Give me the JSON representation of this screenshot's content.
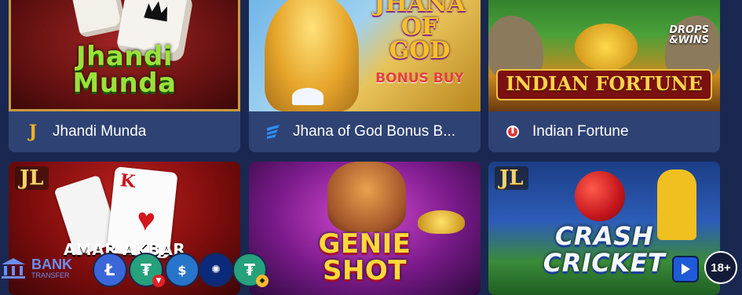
{
  "games": [
    {
      "title": "Jhandi Munda",
      "art_title": "Jhandi\nMunda",
      "provider_icon": "jili-j-icon",
      "badge": ""
    },
    {
      "title": "Jhana of God Bonus B...",
      "art_title": "JHANA\nOF\nGOD",
      "art_subtitle": "BONUS BUY",
      "provider_icon": "wave-provider-icon",
      "badge": ""
    },
    {
      "title": "Indian Fortune",
      "art_title": "INDIAN FORTUNE",
      "provider_icon": "red-circle-provider-icon",
      "badge": "DROPS\n&WINS"
    },
    {
      "title": "",
      "art_title": "AMAR AKBAR",
      "art_badge": "JL",
      "card_letter": "K"
    },
    {
      "title": "",
      "art_title": "GENIE\nSHOT"
    },
    {
      "title": "",
      "art_title": "CRASH\nCRICKET",
      "art_badge": "JL"
    }
  ],
  "payments": {
    "bank_label": "BANK",
    "bank_sub": "TRANSFER",
    "coins": [
      "litecoin-icon",
      "tron-tether-icon",
      "usdc-icon",
      "cardano-icon",
      "tether-icon"
    ]
  },
  "age_badge": "18+",
  "colors": {
    "background": "#1a2750",
    "card": "#2e4274",
    "accent_gold": "#f5d36b"
  }
}
